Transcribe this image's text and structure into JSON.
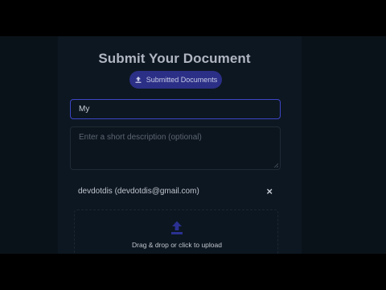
{
  "form": {
    "title": "Submit Your Document",
    "submitted_button_label": "Submitted Documents",
    "title_input_value": "My",
    "description_placeholder": "Enter a short description (optional)",
    "selected_user": "devdotdis (devdotdis@gmail.com)",
    "remove_user_symbol": "×",
    "dropzone_text": "Drag & drop or click to upload"
  },
  "colors": {
    "accent": "#2b2f86",
    "focus_border": "#3d46c4",
    "upload_icon": "#2a3190"
  },
  "icons": {
    "submitted_button_icon": "upload-icon",
    "dropzone_icon": "upload-icon"
  }
}
